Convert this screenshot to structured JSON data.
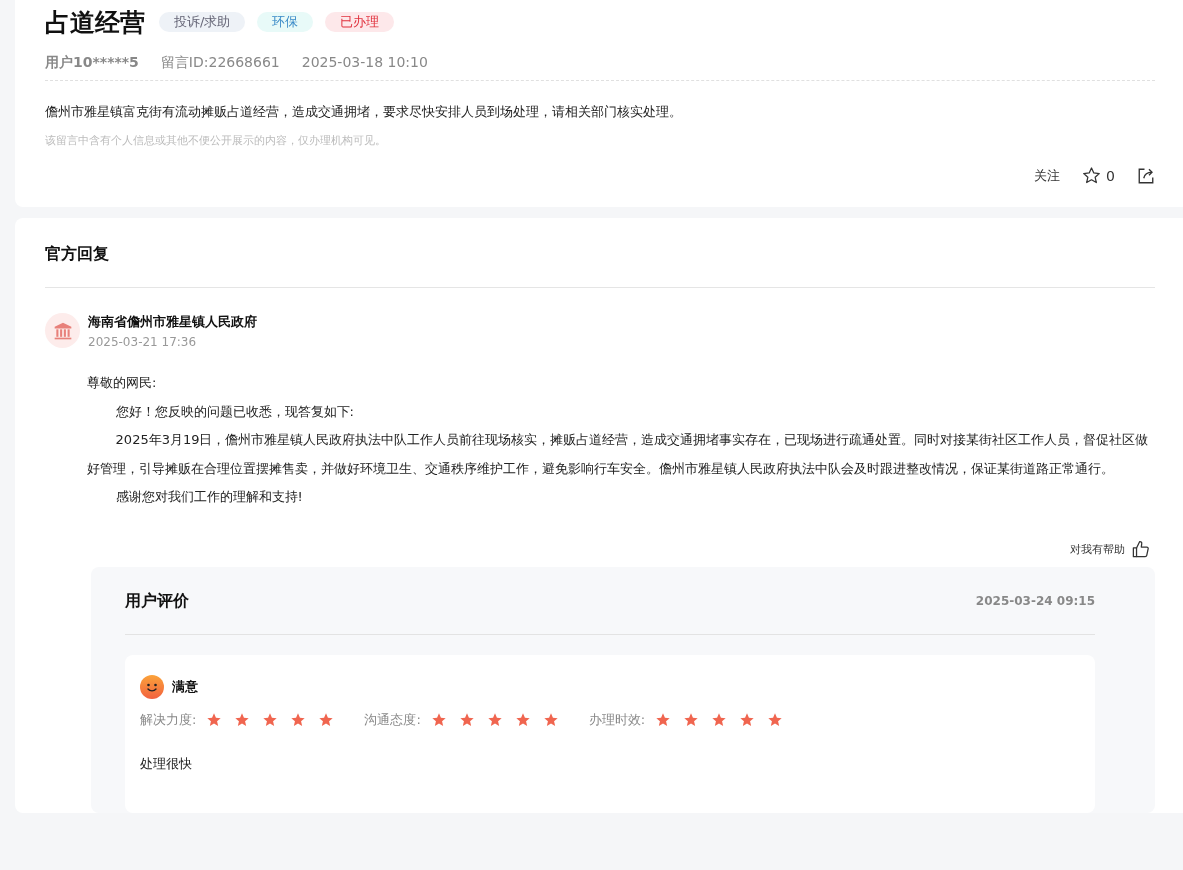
{
  "message": {
    "title": "占道经营",
    "tags": [
      {
        "label": "投诉/求助",
        "color": "#eef2f7"
      },
      {
        "label": "环保",
        "color": "#e8faf8"
      },
      {
        "label": "已办理",
        "color": "#fde8ea"
      }
    ],
    "user": "用户10*****5",
    "message_id": "留言ID:22668661",
    "time": "2025-03-18 10:10",
    "content": "儋州市雅星镇富克街有流动摊贩占道经营，造成交通拥堵，要求尽快安排人员到场处理，请相关部门核实处理。",
    "privacy_note": "该留言中含有个人信息或其他不便公开展示的内容，仅办理机构可见。",
    "follow": "关注",
    "favorite_count": "0"
  },
  "reply": {
    "heading": "官方回复",
    "org": "海南省儋州市雅星镇人民政府",
    "time": "2025-03-21 17:36",
    "paragraphs": [
      {
        "text": "尊敬的网民:",
        "kind": "salutation"
      },
      {
        "text": "您好！您反映的问题已收悉，现答复如下:",
        "kind": "indented"
      },
      {
        "text": "2025年3月19日，儋州市雅星镇人民政府执法中队工作人员前往现场核实，摊贩占道经营，造成交通拥堵事实存在，已现场进行疏通处置。同时对接某街社区工作人员，督促社区做好管理，引导摊贩在合理位置摆摊售卖，并做好环境卫生、交通秩序维护工作，避免影响行车安全。儋州市雅星镇人民政府执法中队会及时跟进整改情况，保证某街道路正常通行。",
        "kind": "indented"
      },
      {
        "text": "感谢您对我们工作的理解和支持!",
        "kind": "indented"
      }
    ],
    "helpful": "对我有帮助"
  },
  "evaluation": {
    "heading": "用户评价",
    "time": "2025-03-24 09:15",
    "verdict": "满意",
    "ratings": [
      {
        "label": "解决力度:",
        "stars": 5
      },
      {
        "label": "沟通态度:",
        "stars": 5
      },
      {
        "label": "办理时效:",
        "stars": 5
      }
    ],
    "comment": "处理很快"
  }
}
